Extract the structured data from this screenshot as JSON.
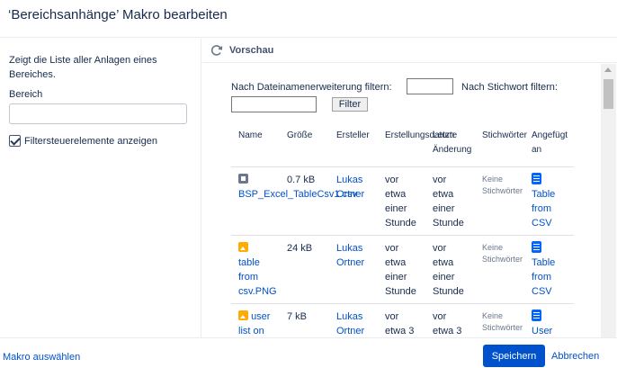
{
  "dialog": {
    "title": "‘Bereichsanhänge’ Makro bearbeiten"
  },
  "left": {
    "description": "Zeigt die Liste aller Anlagen eines Bereiches.",
    "space_label": "Bereich",
    "space_value": "",
    "show_filters_label": "Filtersteuerelemente anzeigen",
    "show_filters_checked": true
  },
  "preview": {
    "title": "Vorschau",
    "filter_ext_label": "Nach Dateinamenerweiterung filtern:",
    "filter_ext_value": "",
    "filter_keyword_label": "Nach Stichwort filtern:",
    "filter_keyword_value": "",
    "filter_button": "Filter",
    "columns": [
      "Name",
      "Größe",
      "Ersteller",
      "Erstellungsdatum",
      "Letzte",
      "Änderung",
      "Stichwörter",
      "Angefügt",
      "an"
    ],
    "rows": [
      {
        "name": "BSP_Excel_TableCsv1.csv",
        "size": "0.7 kB",
        "creator": [
          "Lukas",
          "Ortner"
        ],
        "created": [
          "vor",
          "etwa",
          "einer",
          "Stunde"
        ],
        "modified": [
          "vor",
          "etwa",
          "einer",
          "Stunde"
        ],
        "keywords": [
          "Keine",
          "Stichwörter"
        ],
        "attached": [
          "Table",
          "from",
          "CSV"
        ]
      },
      {
        "name": [
          "table",
          "from",
          "csv.PNG"
        ],
        "size": "24 kB",
        "creator": [
          "Lukas",
          "Ortner"
        ],
        "created": [
          "vor",
          "etwa",
          "einer",
          "Stunde"
        ],
        "modified": [
          "vor",
          "etwa",
          "einer",
          "Stunde"
        ],
        "keywords": [
          "Keine",
          "Stichwörter"
        ],
        "attached": [
          "Table",
          "from",
          "CSV"
        ]
      },
      {
        "name": [
          "user",
          "list on"
        ],
        "size": "7 kB",
        "creator": [
          "Lukas",
          "Ortner"
        ],
        "created": [
          "vor",
          "etwa 3"
        ],
        "modified": [
          "vor",
          "etwa 3"
        ],
        "keywords": [
          "Keine",
          "Stichwörter"
        ],
        "attached": [
          "User"
        ]
      }
    ]
  },
  "footer": {
    "select_macro": "Makro auswählen",
    "save": "Speichern",
    "cancel": "Abbrechen"
  },
  "colors": {
    "primary": "#0052cc",
    "text": "#172b4d",
    "muted": "#6b778c",
    "border": "#dfe1e6"
  },
  "icons": [
    "refresh-icon",
    "file-icon",
    "image-icon",
    "page-icon",
    "checkbox-checked-icon"
  ]
}
